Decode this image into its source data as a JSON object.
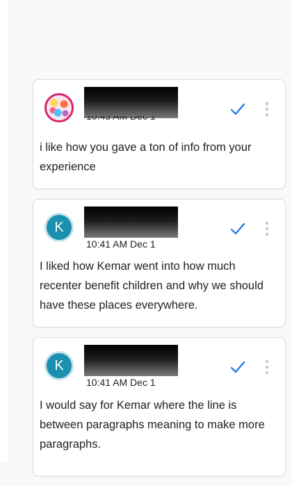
{
  "comments": [
    {
      "time": "10:43 AM Dec 1",
      "text": "i like how you gave a ton of info from your experience"
    },
    {
      "avatar_letter": "K",
      "time": "10:41 AM Dec 1",
      "text": "I liked how Kemar went into how much recenter benefit children and why we should have these places everywhere."
    },
    {
      "avatar_letter": "K",
      "time": "10:41 AM Dec 1",
      "text": "I would say for Kemar where the line is between paragraphs meaning to make more paragraphs."
    }
  ],
  "colors": {
    "accent": "#1a73e8",
    "avatar_teal": "#1a8fae",
    "avatar_pattern_border": "#d6246e"
  },
  "icons": {
    "resolve": "check-icon",
    "more": "more-vert-icon"
  }
}
